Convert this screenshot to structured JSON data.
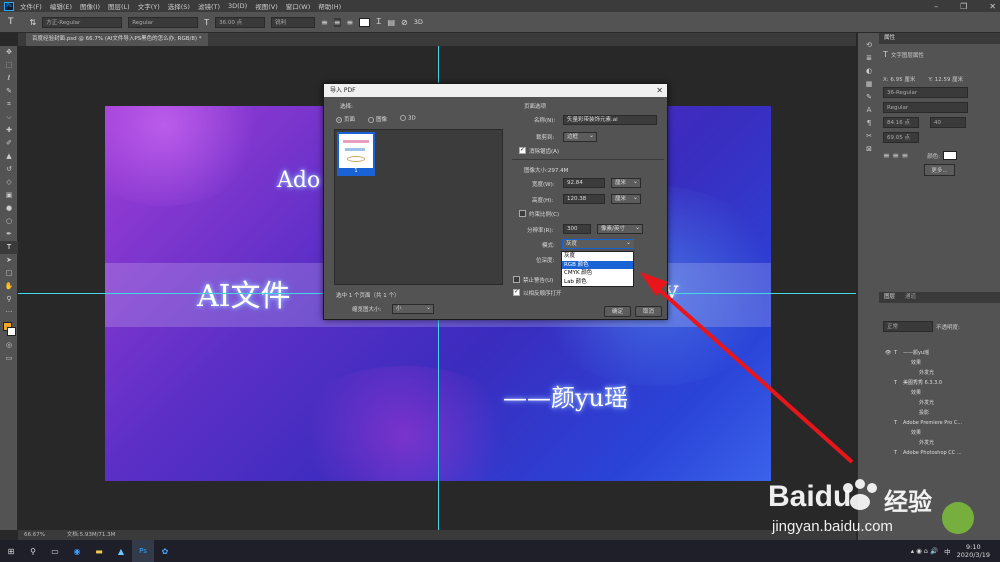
{
  "menubar": {
    "items": [
      "文件(F)",
      "编辑(E)",
      "图像(I)",
      "图层(L)",
      "文字(Y)",
      "选择(S)",
      "滤镜(T)",
      "3D(D)",
      "视图(V)",
      "窗口(W)",
      "帮助(H)"
    ]
  },
  "options": {
    "font_placeholder": "方正-Regular",
    "style_placeholder": "Regular",
    "size_value": "36.00 点",
    "aa_value": "锐利"
  },
  "tab": {
    "title": "百度经验封面.psd @ 66.7% (AI文件导入PS黑色的怎么办, RGB/8) *"
  },
  "canvas": {
    "line1": "Ado",
    "line2": "AI文件",
    "line3_right": "v",
    "author": "——颜yu瑶"
  },
  "status": {
    "zoom": "66.67%",
    "doc": "文档:5.93M/71.3M"
  },
  "dialog": {
    "title": "导入 PDF",
    "select_label": "选择:",
    "radio_page": "页面",
    "radio_image": "图像",
    "radio_3d": "3D",
    "thumb_num": "1",
    "selected_count": "选中 1 个页面（共 1 个）",
    "thumb_size_label": "缩览图大小:",
    "thumb_size_value": "小",
    "page_options": "页面选项",
    "name_label": "名称(N):",
    "name_value": "矢量彩带装饰元素.ai",
    "crop_label": "裁剪到:",
    "crop_value": "边框",
    "antialias": "消除锯齿(A)",
    "image_size": "图像大小:297.4M",
    "width_label": "宽度(W):",
    "width_value": "92.84",
    "width_unit": "厘米",
    "height_label": "高度(H):",
    "height_value": "120.38",
    "height_unit": "厘米",
    "constrain": "约束比例(C)",
    "res_label": "分辨率(R):",
    "res_value": "300",
    "res_unit": "像素/英寸",
    "mode_label": "模式:",
    "mode_value": "灰度",
    "depth_label": "位深度:",
    "suppress": "禁止警告(U)",
    "reverse": "以相反顺序打开",
    "ok": "确定",
    "cancel": "取消",
    "mode_options": [
      "灰度",
      "RGB 颜色",
      "CMYK 颜色",
      "Lab 颜色"
    ],
    "mode_highlight_index": 1
  },
  "props": {
    "tab": "属性",
    "subtitle": "文字图层属性",
    "x": "X: 6.95 厘米",
    "y": "Y: 12.59 厘米",
    "font": "36-Regular",
    "style": "Regular",
    "size": "84.16 点",
    "leading": "69.05 点",
    "tracking": "40",
    "color_label": "颜色:",
    "more": "更多..."
  },
  "layers": {
    "tab1": "图层",
    "tab2": "通道",
    "mode": "正常",
    "opacity": "不透明度:",
    "items": [
      "——颜yu瑶",
      "效果",
      "外发光",
      "美图秀秀 6.3.3.0",
      "效果",
      "外发光",
      "投影",
      "Adobe Premiere Pro C...",
      "效果",
      "外发光",
      "Adobe Photoshop CC ..."
    ]
  },
  "taskbar": {
    "time": "9:10",
    "date": "2020/3/19",
    "lang": "中"
  },
  "watermark": {
    "brand": "Baidu",
    "cn": "经验",
    "url": "jingyan.baidu.com"
  },
  "colors": {
    "arrow": "#e8161b",
    "highlight": "#1a63d6",
    "guide": "#3fd8e4"
  }
}
